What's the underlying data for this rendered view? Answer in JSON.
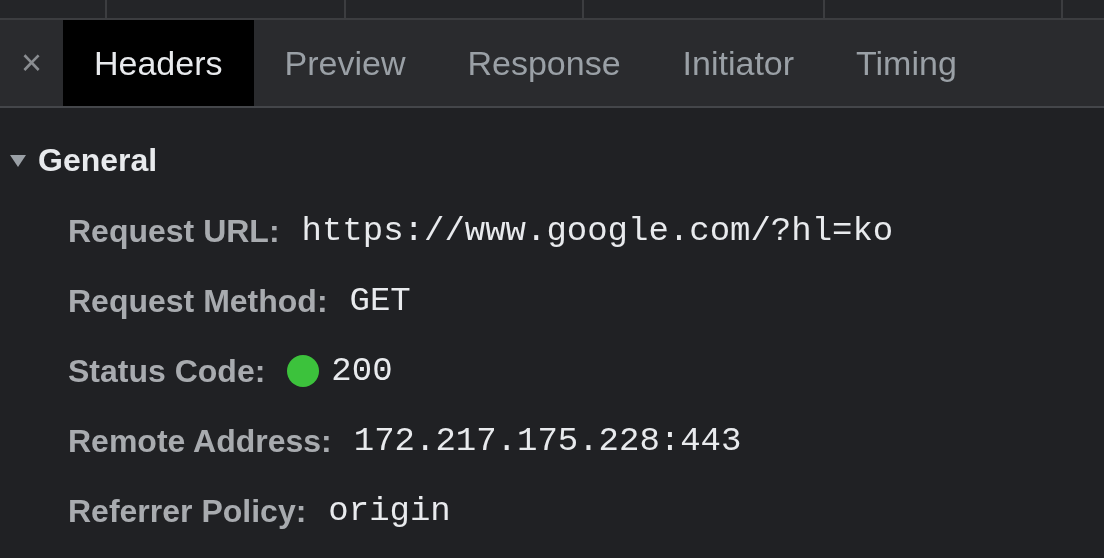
{
  "close_button": "×",
  "tabs": [
    {
      "label": "Headers",
      "selected": true
    },
    {
      "label": "Preview",
      "selected": false
    },
    {
      "label": "Response",
      "selected": false
    },
    {
      "label": "Initiator",
      "selected": false
    },
    {
      "label": "Timing",
      "selected": false
    }
  ],
  "section": {
    "title": "General",
    "expanded": true,
    "rows": [
      {
        "kind": "text",
        "label": "Request URL:",
        "value": "https://www.google.com/?hl=ko"
      },
      {
        "kind": "text",
        "label": "Request Method:",
        "value": "GET"
      },
      {
        "kind": "status",
        "label": "Status Code:",
        "value": "200",
        "color": "#3cc23c"
      },
      {
        "kind": "text",
        "label": "Remote Address:",
        "value": "172.217.175.228:443"
      },
      {
        "kind": "text",
        "label": "Referrer Policy:",
        "value": "origin"
      }
    ]
  }
}
